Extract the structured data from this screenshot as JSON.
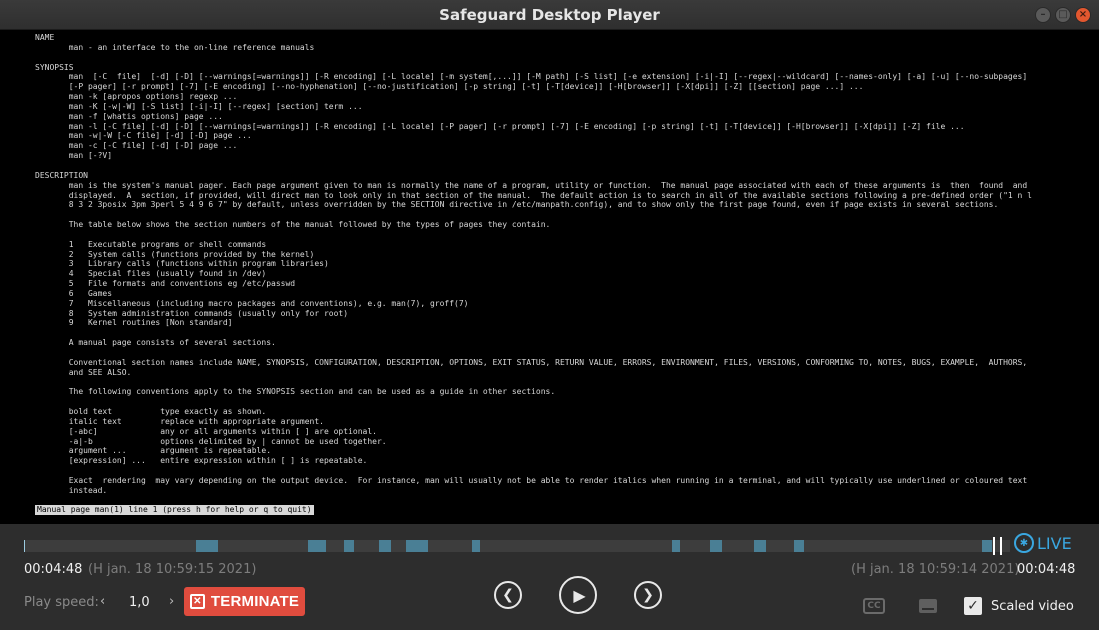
{
  "window": {
    "title": "Safeguard Desktop Player"
  },
  "terminal": {
    "lines": [
      "NAME",
      "       man - an interface to the on-line reference manuals",
      "",
      "SYNOPSIS",
      "       man  [-C  file]  [-d] [-D] [--warnings[=warnings]] [-R encoding] [-L locale] [-m system[,...]] [-M path] [-S list] [-e extension] [-i|-I] [--regex|--wildcard] [--names-only] [-a] [-u] [--no-subpages]",
      "       [-P pager] [-r prompt] [-7] [-E encoding] [--no-hyphenation] [--no-justification] [-p string] [-t] [-T[device]] [-H[browser]] [-X[dpi]] [-Z] [[section] page ...] ...",
      "       man -k [apropos options] regexp ...",
      "       man -K [-w|-W] [-S list] [-i|-I] [--regex] [section] term ...",
      "       man -f [whatis options] page ...",
      "       man -l [-C file] [-d] [-D] [--warnings[=warnings]] [-R encoding] [-L locale] [-P pager] [-r prompt] [-7] [-E encoding] [-p string] [-t] [-T[device]] [-H[browser]] [-X[dpi]] [-Z] file ...",
      "       man -w|-W [-C file] [-d] [-D] page ...",
      "       man -c [-C file] [-d] [-D] page ...",
      "       man [-?V]",
      "",
      "DESCRIPTION",
      "       man is the system's manual pager. Each page argument given to man is normally the name of a program, utility or function.  The manual page associated with each of these arguments is  then  found  and",
      "       displayed.  A  section, if provided, will direct man to look only in that section of the manual.  The default action is to search in all of the available sections following a pre-defined order (\"1 n l",
      "       8 3 2 3posix 3pm 3perl 5 4 9 6 7\" by default, unless overridden by the SECTION directive in /etc/manpath.config), and to show only the first page found, even if page exists in several sections.",
      "",
      "       The table below shows the section numbers of the manual followed by the types of pages they contain.",
      "",
      "       1   Executable programs or shell commands",
      "       2   System calls (functions provided by the kernel)",
      "       3   Library calls (functions within program libraries)",
      "       4   Special files (usually found in /dev)",
      "       5   File formats and conventions eg /etc/passwd",
      "       6   Games",
      "       7   Miscellaneous (including macro packages and conventions), e.g. man(7), groff(7)",
      "       8   System administration commands (usually only for root)",
      "       9   Kernel routines [Non standard]",
      "",
      "       A manual page consists of several sections.",
      "",
      "       Conventional section names include NAME, SYNOPSIS, CONFIGURATION, DESCRIPTION, OPTIONS, EXIT STATUS, RETURN VALUE, ERRORS, ENVIRONMENT, FILES, VERSIONS, CONFORMING TO, NOTES, BUGS, EXAMPLE,  AUTHORS,",
      "       and SEE ALSO.",
      "",
      "       The following conventions apply to the SYNOPSIS section and can be used as a guide in other sections.",
      "",
      "       bold text          type exactly as shown.",
      "       italic text        replace with appropriate argument.",
      "       [-abc]             any or all arguments within [ ] are optional.",
      "       -a|-b              options delimited by | cannot be used together.",
      "       argument ...       argument is repeatable.",
      "       [expression] ...   entire expression within [ ] is repeatable.",
      "",
      "       Exact  rendering  may vary depending on the output device.  For instance, man will usually not be able to render italics when running in a terminal, and will typically use underlined or coloured text",
      "       instead."
    ],
    "status_line": "Manual page man(1) line 1 (press h for help or q to quit)"
  },
  "player": {
    "live_label": "LIVE",
    "current_time": "00:04:48",
    "current_date": "(H jan. 18 10:59:15 2021)",
    "end_date": "(H jan. 18 10:59:14 2021)",
    "end_time": "00:04:48",
    "speed_label": "Play speed:",
    "speed_value": "1,0",
    "speed_decrease": "‹",
    "speed_increase": "›",
    "terminate_label": "TERMINATE",
    "scaled_video_label": "Scaled video",
    "scaled_video_checked": true,
    "accent_color": "#3aa7e0",
    "terminate_color": "#e04c3e"
  }
}
